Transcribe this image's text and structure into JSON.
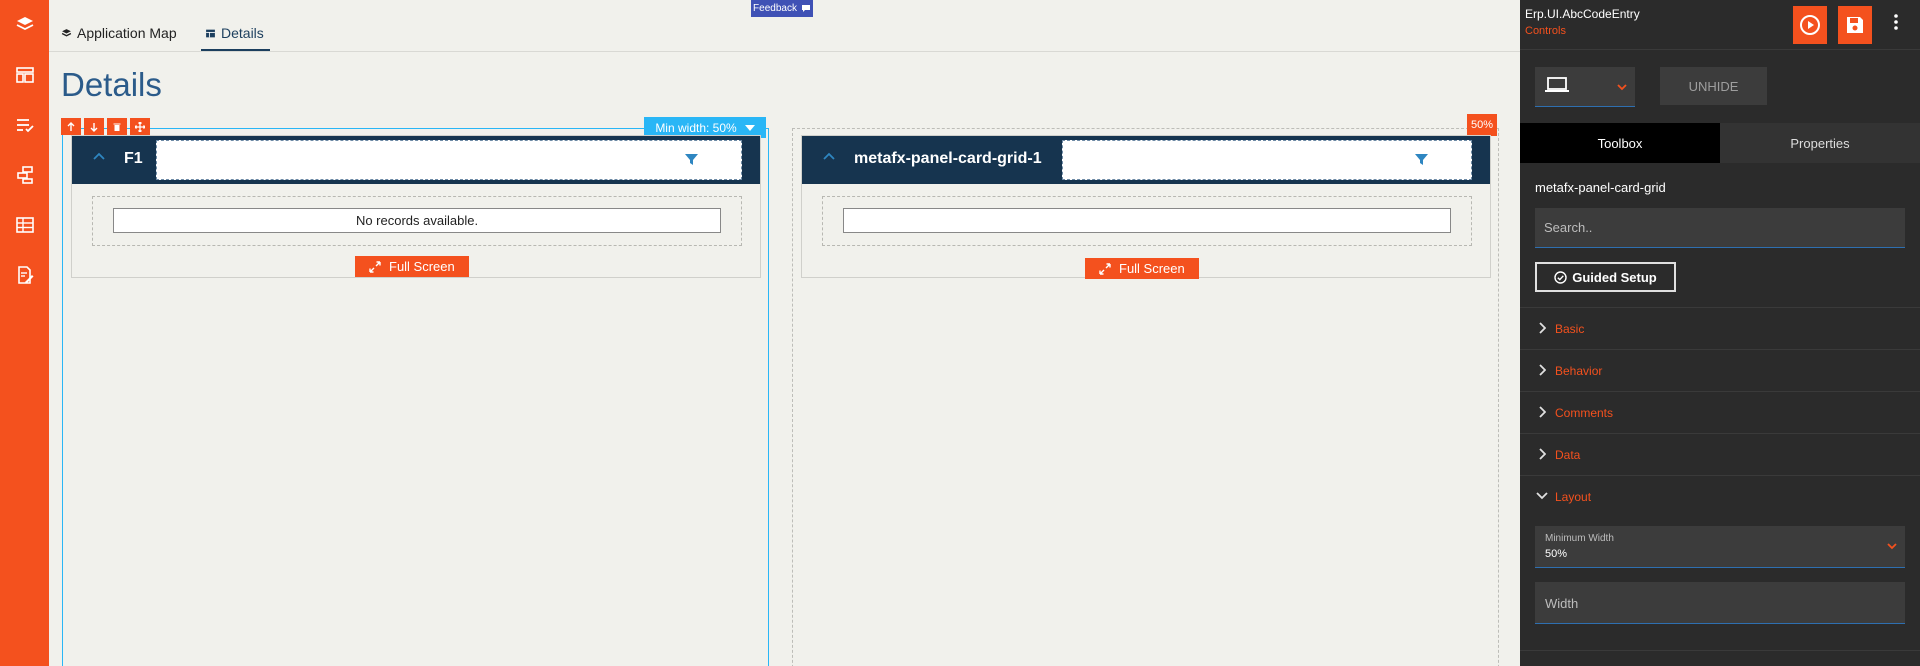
{
  "rail": {
    "icons": [
      "layers-icon",
      "dashboard-icon",
      "checklist-icon",
      "workflow-icon",
      "table-icon",
      "document-edit-icon"
    ]
  },
  "tabs": [
    {
      "label": "Application Map",
      "icon": "layers-icon"
    },
    {
      "label": "Details",
      "icon": "table-icon"
    }
  ],
  "feedback": {
    "label": "Feedback"
  },
  "page": {
    "title": "Details"
  },
  "selection": {
    "min_width_label": "Min width: 50%",
    "percent_label": "50%"
  },
  "cards": [
    {
      "title": "F1",
      "empty_message": "No records available.",
      "fullscreen_label": "Full Screen"
    },
    {
      "title": "metafx-panel-card-grid-1",
      "empty_message": "",
      "fullscreen_label": "Full Screen"
    }
  ],
  "panel": {
    "app_name": "Erp.UI.AbcCodeEntry",
    "subtitle": "Controls",
    "unhide_label": "UNHIDE",
    "tabs": [
      "Toolbox",
      "Properties"
    ],
    "component_name": "metafx-panel-card-grid",
    "search_placeholder": "Search..",
    "guided_setup_label": "Guided Setup",
    "sections": [
      "Basic",
      "Behavior",
      "Comments",
      "Data",
      "Layout"
    ],
    "minimum_width": {
      "label": "Minimum Width",
      "value": "50%"
    },
    "width_placeholder": "Width"
  },
  "colors": {
    "accent": "#f4511e",
    "card_header": "#16344f",
    "selection": "#29b6f6",
    "panel_bg": "#2b2b2b"
  }
}
